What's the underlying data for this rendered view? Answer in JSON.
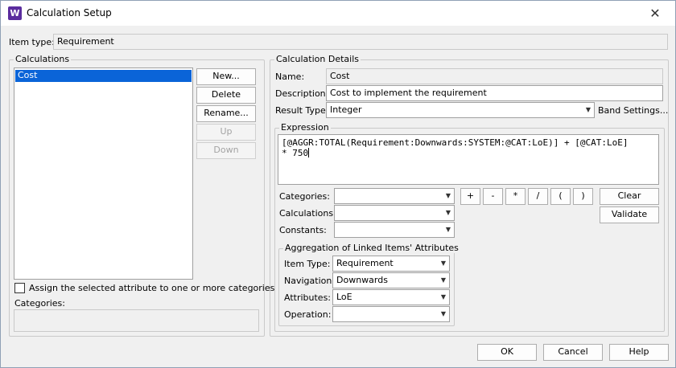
{
  "window": {
    "title": "Calculation Setup",
    "icon_letter": "W",
    "close_glyph": "✕"
  },
  "item_type": {
    "label": "Item type:",
    "value": "Requirement"
  },
  "calculations": {
    "title": "Calculations",
    "items": [
      "Cost"
    ],
    "selected": "Cost",
    "buttons": {
      "new": "New...",
      "delete": "Delete",
      "rename": "Rename...",
      "up": "Up",
      "down": "Down"
    },
    "assign_label": "Assign the selected attribute to one or more categories",
    "categories_label": "Categories:",
    "categories_value": ""
  },
  "details": {
    "title": "Calculation Details",
    "name_label": "Name:",
    "name_value": "Cost",
    "description_label": "Description:",
    "description_value": "Cost to implement the requirement",
    "result_type_label": "Result Type:",
    "result_type_value": "Integer",
    "band_settings": "Band Settings..."
  },
  "expression": {
    "title": "Expression",
    "line1": "[@AGGR:TOTAL(Requirement:Downwards:SYSTEM:@CAT:LoE)] + [@CAT:LoE]",
    "line2": "* 750",
    "categories_label": "Categories:",
    "calculations_label": "Calculations:",
    "constants_label": "Constants:",
    "categories_value": "",
    "calculations_value": "",
    "constants_value": "",
    "operators": [
      "+",
      "-",
      "*",
      "/",
      "(",
      ")"
    ],
    "clear": "Clear",
    "validate": "Validate"
  },
  "aggregation": {
    "title": "Aggregation of Linked Items' Attributes",
    "item_type_label": "Item Type:",
    "item_type_value": "Requirement",
    "navigation_label": "Navigation:",
    "navigation_value": "Downwards",
    "attributes_label": "Attributes:",
    "attributes_value": "LoE",
    "operation_label": "Operation:",
    "operation_value": ""
  },
  "footer": {
    "ok": "OK",
    "cancel": "Cancel",
    "help": "Help"
  }
}
